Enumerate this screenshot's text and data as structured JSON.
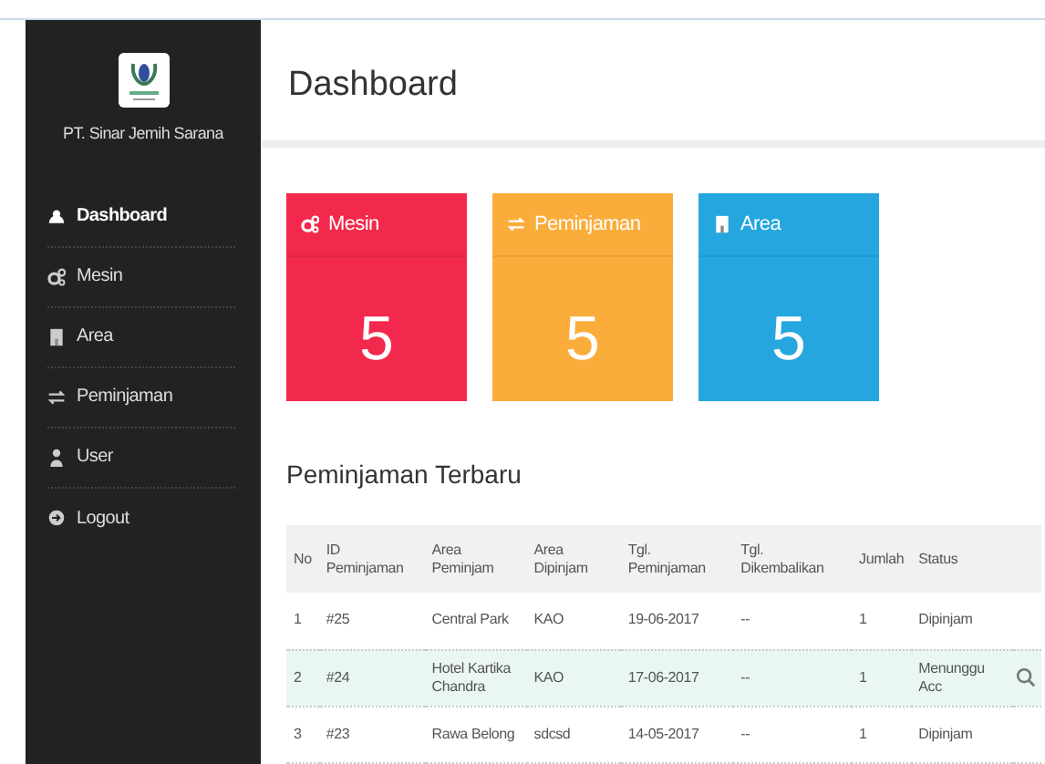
{
  "sidebar": {
    "company": "PT. Sinar Jemih Sarana",
    "items": [
      {
        "label": "Dashboard",
        "selected": true
      },
      {
        "label": "Mesin",
        "selected": false
      },
      {
        "label": "Area",
        "selected": false
      },
      {
        "label": "Peminjaman",
        "selected": false
      },
      {
        "label": "User",
        "selected": false
      },
      {
        "label": "Logout",
        "selected": false
      }
    ]
  },
  "page_title": "Dashboard",
  "stat_cards": [
    {
      "label": "Mesin",
      "value": "5",
      "color": "#f2284c"
    },
    {
      "label": "Peminjaman",
      "value": "5",
      "color": "#fbad3b"
    },
    {
      "label": "Area",
      "value": "5",
      "color": "#25a6de"
    }
  ],
  "section_title": "Peminjaman Terbaru",
  "table": {
    "columns": [
      "No",
      "ID Peminjaman",
      "Area Peminjam",
      "Area Dipinjam",
      "Tgl. Peminjaman",
      "Tgl. Dikembalikan",
      "Jumlah",
      "Status"
    ],
    "rows": [
      {
        "cells": [
          "1",
          "#25",
          "Central Park",
          "KAO",
          "19-06-2017",
          "--",
          "1",
          "Dipinjam"
        ],
        "selected": false,
        "search_action": false
      },
      {
        "cells": [
          "2",
          "#24",
          "Hotel Kartika Chandra",
          "KAO",
          "17-06-2017",
          "--",
          "1",
          "Menunggu Acc"
        ],
        "selected": true,
        "search_action": true
      },
      {
        "cells": [
          "3",
          "#23",
          "Rawa Belong",
          "sdcsd",
          "14-05-2017",
          "--",
          "1",
          "Dipinjam"
        ],
        "selected": false,
        "search_action": false
      }
    ]
  }
}
